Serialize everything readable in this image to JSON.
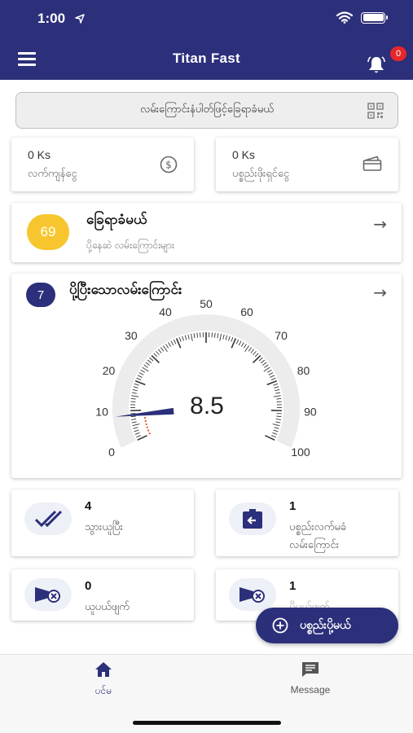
{
  "status_bar": {
    "time": "1:00"
  },
  "header": {
    "title": "Titan Fast",
    "notification_count": "0"
  },
  "scan_bar": {
    "label": "လမ်းကြောင်းနံပါတ်ဖြင့်ခြေရာခံမယ်"
  },
  "balances": [
    {
      "amount": "0 Ks",
      "label": "လက်ကျန်ငွေ",
      "icon": "dollar-coin-icon"
    },
    {
      "amount": "0 Ks",
      "label": "ပစ္စည်းဖိုးရှင်ငွေ",
      "icon": "wallet-icon"
    }
  ],
  "tracking_card": {
    "count": "69",
    "title": "ခြေရာခံမယ်",
    "subtitle": "ပို့နေဆဲ လမ်းကြောင်းများ",
    "badge_color": "#f7c62f"
  },
  "delivered_card": {
    "count": "7",
    "title": "ပို့ပြီးသောလမ်းကြောင်း"
  },
  "gauge": {
    "value": "8.5",
    "value_num": 8.5,
    "min": 0,
    "max": 100,
    "ticks": [
      "0",
      "10",
      "20",
      "30",
      "40",
      "50",
      "60",
      "70",
      "80",
      "90",
      "100"
    ]
  },
  "stats": [
    {
      "num": "4",
      "label": "သွားယူပြီး",
      "icon": "double-check-icon"
    },
    {
      "num": "1",
      "label": "ပစ္စည်းလက်မခံလမ်းကြောင်း",
      "label_line1": "ပစ္စည်းလက်မခံ",
      "label_line2": "လမ်းကြောင်း",
      "icon": "return-box-icon"
    },
    {
      "num": "0",
      "label": "ယူပယ်ဖျက်",
      "icon": "cancel-ticket-icon"
    },
    {
      "num": "1",
      "label": "ပို့ပယ်ဖျက်",
      "icon": "cancel-ticket-icon"
    }
  ],
  "fab": {
    "label": "ပစ္စည်းပို့မယ်"
  },
  "tabs": [
    {
      "label": "ပင်မ",
      "icon": "home-icon",
      "active": true
    },
    {
      "label": "Message",
      "icon": "message-icon",
      "active": false
    }
  ],
  "colors": {
    "primary": "#2c2f7a",
    "accent_yellow": "#f7c62f",
    "badge_red": "#e5262a",
    "gauge_needle": "#2c2f7a",
    "gauge_fill": "#e8582a"
  }
}
